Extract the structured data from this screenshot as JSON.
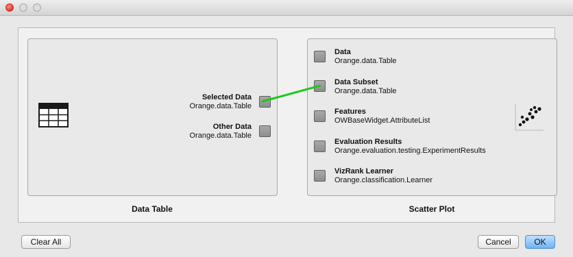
{
  "window": {
    "title": ""
  },
  "source_widget": {
    "name": "Data Table",
    "icon": "table-icon",
    "outputs": [
      {
        "name": "Selected Data",
        "type": "Orange.data.Table"
      },
      {
        "name": "Other Data",
        "type": "Orange.data.Table"
      }
    ]
  },
  "sink_widget": {
    "name": "Scatter Plot",
    "icon": "scatter-plot-icon",
    "inputs": [
      {
        "name": "Data",
        "type": "Orange.data.Table"
      },
      {
        "name": "Data Subset",
        "type": "Orange.data.Table"
      },
      {
        "name": "Features",
        "type": "OWBaseWidget.AttributeList"
      },
      {
        "name": "Evaluation Results",
        "type": "Orange.evaluation.testing.ExperimentResults"
      },
      {
        "name": "VizRank Learner",
        "type": "Orange.classification.Learner"
      }
    ]
  },
  "links": [
    {
      "from": "Selected Data",
      "to": "Data Subset",
      "color": "#1ec81e"
    }
  ],
  "buttons": {
    "clear_all": "Clear All",
    "cancel": "Cancel",
    "ok": "OK"
  }
}
